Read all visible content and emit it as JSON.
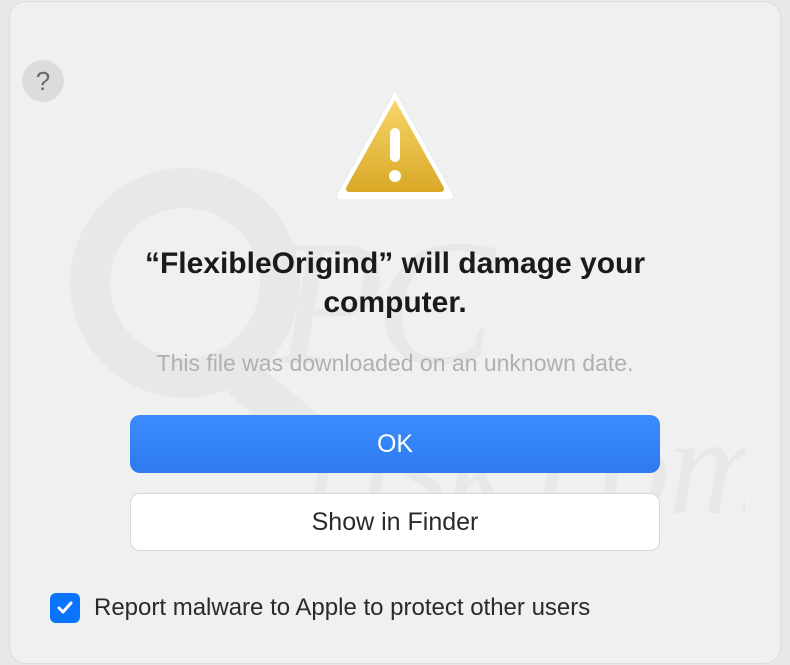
{
  "dialog": {
    "help_symbol": "?",
    "heading": "“FlexibleOrigind” will damage your computer.",
    "subtext": "This file was downloaded on an unknown date.",
    "primary_button": "OK",
    "secondary_button": "Show in Finder",
    "checkbox_label": "Report malware to Apple to protect other users",
    "checkbox_checked": true
  },
  "colors": {
    "primary": "#2e7af0",
    "dialog_bg": "#f0f0f0",
    "text_muted": "#b0b0b0"
  }
}
